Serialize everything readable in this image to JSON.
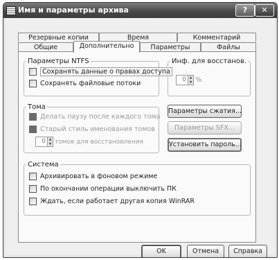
{
  "window": {
    "title": "Имя и параметры архива",
    "help_label": "?",
    "close_label": "✕"
  },
  "tabs_back": [
    "Резервные копии",
    "Время",
    "Комментарий"
  ],
  "tabs_front": [
    "Общие",
    "Дополнительно",
    "Параметры",
    "Файлы"
  ],
  "active_tab": "Дополнительно",
  "ntfs": {
    "legend": "Параметры NTFS",
    "save_security": "Сохранять данные о правах доступа",
    "save_streams": "Сохранять файловые потоки"
  },
  "recovery": {
    "legend": "Инф. для восстанов.",
    "value": "0",
    "unit": "%"
  },
  "volumes": {
    "legend": "Тома",
    "pause_each": "Делать паузу после каждого тома",
    "old_naming": "Старый стиль именования томов",
    "recovery_volumes_value": "0",
    "recovery_volumes_label": "томов для восстановления"
  },
  "buttons": {
    "compression": "Параметры сжатия...",
    "sfx": "Параметры SFX...",
    "password": "Установить пароль..."
  },
  "system": {
    "legend": "Система",
    "background": "Архивировать в фоновом режиме",
    "shutdown": "По окончании операции выключить ПК",
    "wait": "Ждать, если работает другая копия WinRAR"
  },
  "footer": {
    "ok": "OK",
    "cancel": "Отмена",
    "help": "Справка"
  }
}
